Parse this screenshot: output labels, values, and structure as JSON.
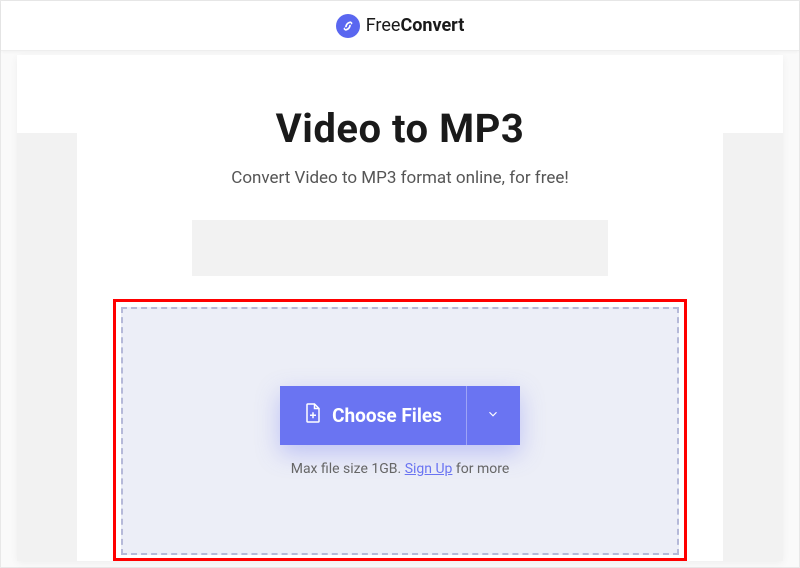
{
  "header": {
    "logo_text_light": "Free",
    "logo_text_bold": "Convert"
  },
  "main": {
    "title": "Video to MP3",
    "subtitle": "Convert Video to MP3 format online, for free!"
  },
  "upload": {
    "choose_files_label": "Choose Files",
    "hint_prefix": "Max file size 1GB. ",
    "hint_link": "Sign Up",
    "hint_suffix": " for more"
  },
  "colors": {
    "accent": "#6a74f2",
    "highlight_border": "#ff0000",
    "dashed_border": "#b5b9d9",
    "drop_bg": "#eceef7"
  }
}
